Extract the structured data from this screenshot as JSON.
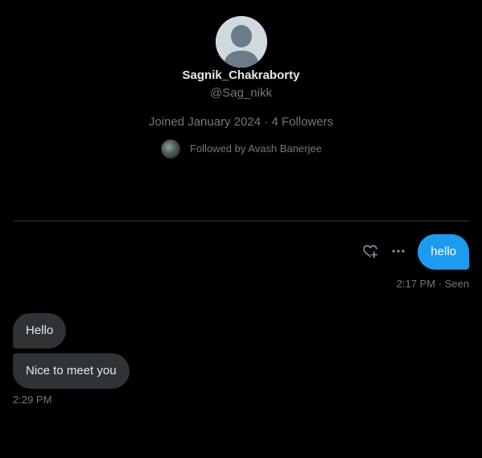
{
  "profile": {
    "display_name": "Sagnik_Chakraborty",
    "handle": "@Sag_nikk",
    "joined": "Joined January 2024",
    "separator": " · ",
    "followers": "4 Followers",
    "followed_by": "Followed by Avash Banerjee"
  },
  "conversation": {
    "sent": [
      {
        "text": "hello",
        "time": "2:17 PM",
        "status_separator": " · ",
        "status": "Seen"
      }
    ],
    "received": [
      {
        "text": "Hello"
      },
      {
        "text": "Nice to meet you"
      }
    ],
    "received_time": "2:29 PM"
  },
  "icons": {
    "react": "heart-plus-icon",
    "more": "more-horizontal-icon",
    "avatar": "default-avatar-icon"
  },
  "colors": {
    "background": "#000000",
    "sent_bubble": "#1d9bf0",
    "received_bubble": "#2f3336",
    "primary_text": "#e7e9ea",
    "secondary_text": "#71767b",
    "divider": "#2f3336"
  }
}
